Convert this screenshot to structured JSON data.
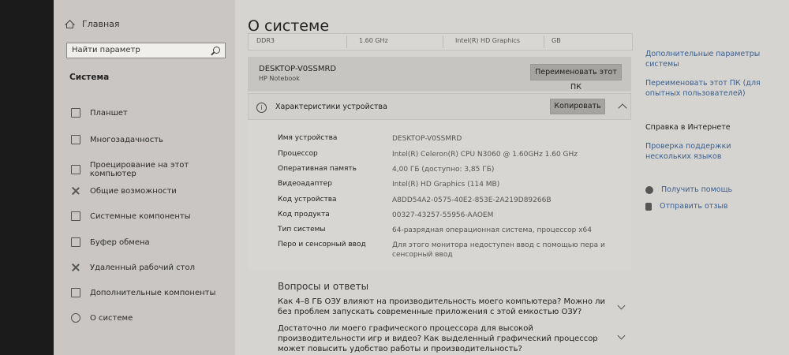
{
  "sidebar": {
    "home_label": "Главная",
    "search_placeholder": "Найти параметр",
    "section_title": "Система",
    "items": [
      {
        "label": "Планшет",
        "icon": "tablet-icon"
      },
      {
        "label": "Многозадачность",
        "icon": "multitasking-icon"
      },
      {
        "label": "Проецирование на этот компьютер",
        "icon": "projecting-icon"
      },
      {
        "label": "Общие возможности",
        "icon": "shared-experiences-icon"
      },
      {
        "label": "Системные компоненты",
        "icon": "system-components-icon"
      },
      {
        "label": "Буфер обмена",
        "icon": "clipboard-icon"
      },
      {
        "label": "Удаленный рабочий стол",
        "icon": "remote-desktop-icon"
      },
      {
        "label": "Дополнительные компоненты",
        "icon": "optional-features-icon"
      },
      {
        "label": "О системе",
        "icon": "info-icon"
      }
    ]
  },
  "main": {
    "title": "О системе",
    "top_strip": [
      "DDR3",
      "1.60 GHz",
      "Intel(R) HD Graphics",
      "GB"
    ],
    "device_card": {
      "name": "DESKTOP-V0SSMRD",
      "model": "HP Notebook",
      "rename_button": "Переименовать этот ПК"
    },
    "specs": {
      "title": "Характеристики устройства",
      "copy_button": "Копировать",
      "rows": [
        {
          "key": "Имя устройства",
          "value": "DESKTOP-V0SSMRD"
        },
        {
          "key": "Процессор",
          "value": "Intel(R) Celeron(R) CPU  N3060 @ 1.60GHz   1.60 GHz"
        },
        {
          "key": "Оперативная память",
          "value": "4,00 ГБ (доступно: 3,85 ГБ)"
        },
        {
          "key": "Видеоадаптер",
          "value": "Intel(R) HD Graphics (114 MB)"
        },
        {
          "key": "Код устройства",
          "value": "A8DD54A2-0575-40E2-853E-2A219D89266B"
        },
        {
          "key": "Код продукта",
          "value": "00327-43257-55956-AAOEM"
        },
        {
          "key": "Тип системы",
          "value": "64-разрядная операционная система, процессор x64"
        },
        {
          "key": "Перо и сенсорный ввод",
          "value": "Для этого монитора недоступен ввод с помощью пера и сенсорный ввод"
        }
      ]
    },
    "qa": {
      "title": "Вопросы и ответы",
      "items": [
        "Как 4–8 ГБ ОЗУ влияют на производительность моего компьютера? Можно ли без проблем запускать современные приложения с этой емкостью ОЗУ?",
        "Достаточно ли моего графического процессора для высокой производительности игр и видео? Как выделенный графический процессор может повысить удобство работы и производительность?"
      ]
    }
  },
  "right_panel": {
    "links": [
      "Дополнительные параметры системы",
      "Переименовать этот ПК (для опытных пользователей)"
    ],
    "help_heading": "Справка в Интернете",
    "help_link": "Проверка поддержки нескольких языков",
    "actions": [
      "Получить помощь",
      "Отправить отзыв"
    ]
  }
}
